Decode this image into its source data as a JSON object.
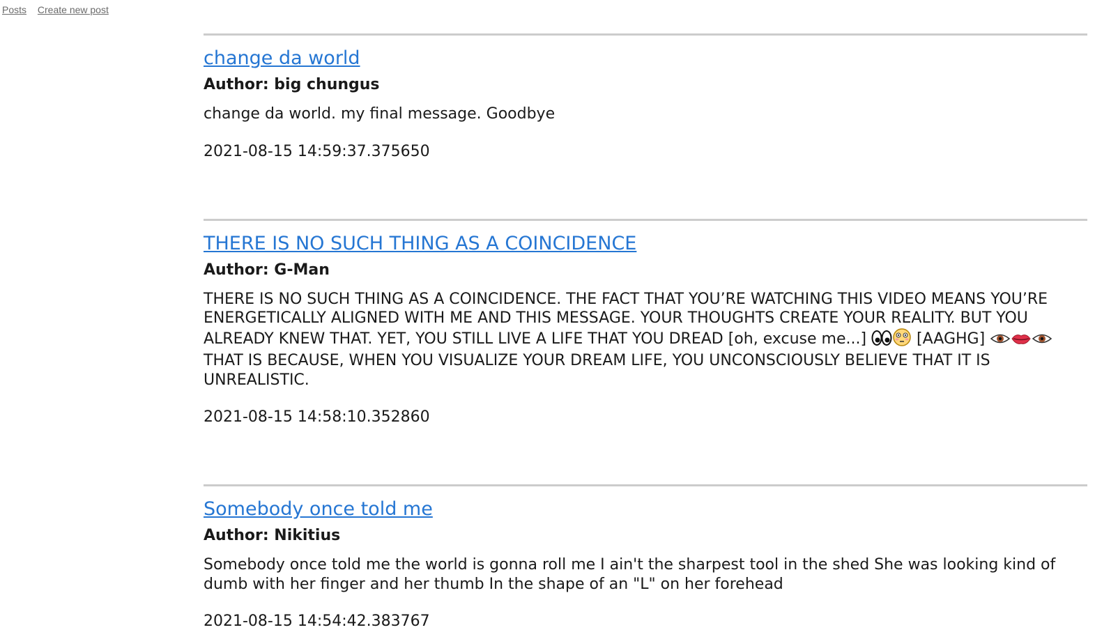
{
  "nav": {
    "posts_label": "Posts",
    "create_label": "Create new post"
  },
  "posts": [
    {
      "title": "change da world",
      "author": "Author: big chungus",
      "content": "change da world. my final message. Goodbye",
      "date": "2021-08-15 14:59:37.375650"
    },
    {
      "title": "THERE IS NO SUCH THING AS A COINCIDENCE",
      "author": "Author: G-Man",
      "content_before": "THERE IS NO SUCH THING AS A COINCIDENCE. THE FACT THAT YOU’RE WATCHING THIS VIDEO MEANS YOU’RE ENERGETICALLY ALIGNED WITH ME AND THIS MESSAGE. YOUR THOUGHTS CREATE YOUR REALITY. BUT YOU ALREADY KNEW THAT. YET, YOU STILL LIVE A LIFE THAT YOU DREAD [oh, excuse me...]",
      "content_middle": "[AAGHG]",
      "content_after": "THAT IS BECAUSE, WHEN YOU VISUALIZE YOUR DREAM LIFE, YOU UNCONSCIOUSLY BELIEVE THAT IT IS UNREALISTIC.",
      "emoji_1": "eyes-emoji",
      "emoji_2": "flushed-face-emoji",
      "emoji_3": "eye-emoji",
      "emoji_4": "mouth-emoji",
      "emoji_5": "eye-emoji",
      "date": "2021-08-15 14:58:10.352860"
    },
    {
      "title": "Somebody once told me",
      "author": "Author: Nikitius",
      "content": "Somebody once told me the world is gonna roll me I ain't the sharpest tool in the shed She was looking kind of dumb with her finger and her thumb In the shape of an \"L\" on her forehead",
      "date": "2021-08-15 14:54:42.383767"
    }
  ],
  "colors": {
    "link": "#2576d3",
    "nav_link": "#6a6a6a",
    "divider": "#cccccc",
    "text": "#1a1a1a"
  }
}
